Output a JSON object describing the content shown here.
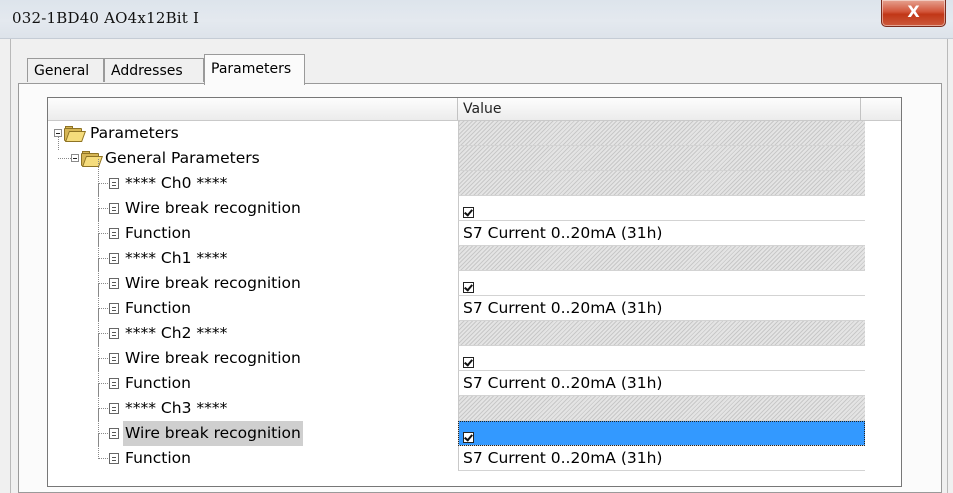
{
  "window": {
    "title": "032-1BD40 AO4x12Bit I",
    "close_glyph": "X"
  },
  "tabs": [
    {
      "label": "General",
      "active": false
    },
    {
      "label": "Addresses",
      "active": false
    },
    {
      "label": "Parameters",
      "active": true
    }
  ],
  "grid": {
    "columns": [
      "",
      "Value",
      ""
    ],
    "rows": [
      {
        "label": "Parameters",
        "level": 0,
        "type": "folder",
        "value_type": "none"
      },
      {
        "label": "General Parameters",
        "level": 1,
        "type": "folder",
        "value_type": "none"
      },
      {
        "label": "**** Ch0 ****",
        "level": 2,
        "type": "param",
        "value_type": "none"
      },
      {
        "label": "Wire break recognition",
        "level": 2,
        "type": "param",
        "value_type": "checkbox",
        "checked": true
      },
      {
        "label": "Function",
        "level": 2,
        "type": "param",
        "value_type": "text",
        "value": "S7 Current 0..20mA (31h)"
      },
      {
        "label": "**** Ch1 ****",
        "level": 2,
        "type": "param",
        "value_type": "none"
      },
      {
        "label": "Wire break recognition",
        "level": 2,
        "type": "param",
        "value_type": "checkbox",
        "checked": true
      },
      {
        "label": "Function",
        "level": 2,
        "type": "param",
        "value_type": "text",
        "value": "S7 Current 0..20mA (31h)"
      },
      {
        "label": "**** Ch2 ****",
        "level": 2,
        "type": "param",
        "value_type": "none"
      },
      {
        "label": "Wire break recognition",
        "level": 2,
        "type": "param",
        "value_type": "checkbox",
        "checked": true
      },
      {
        "label": "Function",
        "level": 2,
        "type": "param",
        "value_type": "text",
        "value": "S7 Current 0..20mA (31h)"
      },
      {
        "label": "**** Ch3 ****",
        "level": 2,
        "type": "param",
        "value_type": "none"
      },
      {
        "label": "Wire break recognition",
        "level": 2,
        "type": "param",
        "value_type": "checkbox",
        "checked": true,
        "selected": true
      },
      {
        "label": "Function",
        "level": 2,
        "type": "param",
        "value_type": "text",
        "value": "S7 Current 0..20mA (31h)"
      }
    ]
  },
  "colors": {
    "selection": "#3399ff",
    "close_button": "#c13717"
  }
}
